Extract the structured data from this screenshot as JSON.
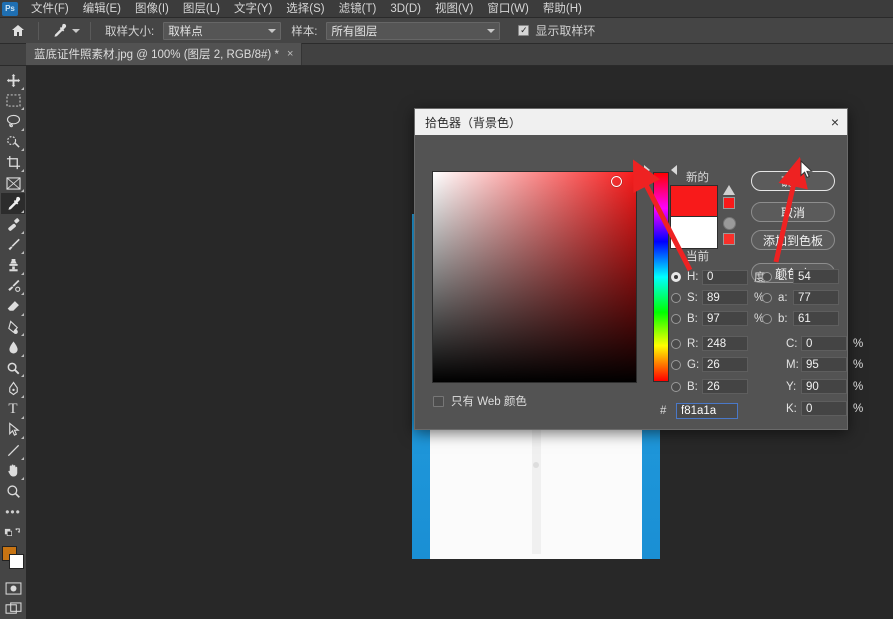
{
  "app": {
    "logo_text": "Ps"
  },
  "menubar": {
    "items": [
      {
        "label": "文件(F)",
        "name": "menu-file"
      },
      {
        "label": "编辑(E)",
        "name": "menu-edit"
      },
      {
        "label": "图像(I)",
        "name": "menu-image"
      },
      {
        "label": "图层(L)",
        "name": "menu-layer"
      },
      {
        "label": "文字(Y)",
        "name": "menu-type"
      },
      {
        "label": "选择(S)",
        "name": "menu-select"
      },
      {
        "label": "滤镜(T)",
        "name": "menu-filter"
      },
      {
        "label": "3D(D)",
        "name": "menu-3d"
      },
      {
        "label": "视图(V)",
        "name": "menu-view"
      },
      {
        "label": "窗口(W)",
        "name": "menu-window"
      },
      {
        "label": "帮助(H)",
        "name": "menu-help"
      }
    ]
  },
  "optionsbar": {
    "home_icon": "home-icon",
    "tool_icon": "eyedropper-icon",
    "sample_size_label": "取样大小:",
    "sample_size_value": "取样点",
    "sample_label": "样本:",
    "sample_value": "所有图层",
    "show_ring_label": "显示取样环",
    "show_ring_checked": true
  },
  "document_tab": {
    "title": "蓝底证件照素材.jpg @ 100% (图层 2, RGB/8#) *",
    "close_glyph": "×"
  },
  "toolbar": {
    "tools": [
      {
        "name": "move-tool",
        "glyph": "✥",
        "active": false
      },
      {
        "name": "marquee-tool",
        "glyph": "▭",
        "active": false
      },
      {
        "name": "lasso-tool",
        "glyph": "✂",
        "active": false
      },
      {
        "name": "quick-selection-tool",
        "glyph": "✐",
        "active": false
      },
      {
        "name": "crop-tool",
        "glyph": "⌗",
        "active": false
      },
      {
        "name": "frame-tool",
        "glyph": "⊠",
        "active": false
      },
      {
        "name": "eyedropper-tool",
        "glyph": "⚲",
        "active": true
      },
      {
        "name": "healing-brush-tool",
        "glyph": "✚",
        "active": false
      },
      {
        "name": "brush-tool",
        "glyph": "✎",
        "active": false
      },
      {
        "name": "clone-stamp-tool",
        "glyph": "♜",
        "active": false
      },
      {
        "name": "history-brush-tool",
        "glyph": "✾",
        "active": false
      },
      {
        "name": "eraser-tool",
        "glyph": "◣",
        "active": false
      },
      {
        "name": "gradient-tool",
        "glyph": "◨",
        "active": false
      },
      {
        "name": "blur-tool",
        "glyph": "◌",
        "active": false
      },
      {
        "name": "dodge-tool",
        "glyph": "●",
        "active": false
      },
      {
        "name": "pen-tool",
        "glyph": "✒",
        "active": false
      },
      {
        "name": "type-tool",
        "glyph": "T",
        "active": false
      },
      {
        "name": "path-selection-tool",
        "glyph": "➤",
        "active": false
      },
      {
        "name": "shape-tool",
        "glyph": "╱",
        "active": false
      },
      {
        "name": "hand-tool",
        "glyph": "✋",
        "active": false
      },
      {
        "name": "zoom-tool",
        "glyph": "🔍",
        "active": false
      }
    ],
    "more_tools_glyph": "•••",
    "foreground_color": "#c77413",
    "background_color": "#ffffff",
    "quickmask_icon": "quick-mask-icon",
    "screenmode_icon": "screen-mode-icon"
  },
  "dialog": {
    "title": "拾色器（背景色）",
    "close_glyph": "×",
    "new_label": "新的",
    "current_label": "当前",
    "new_color": "#f81a1a",
    "current_color": "#ffffff",
    "web_only_label": "只有 Web 颜色",
    "web_only_checked": false,
    "buttons": [
      {
        "name": "ok-button",
        "label": "确定",
        "id": "btn-ok",
        "primary": true
      },
      {
        "name": "cancel-button",
        "label": "取消",
        "id": "btn-cancel",
        "primary": false
      },
      {
        "name": "add-to-swatches-button",
        "label": "添加到色板",
        "id": "btn-addsw",
        "primary": false
      },
      {
        "name": "color-libraries-button",
        "label": "颜色库",
        "id": "btn-lib",
        "primary": false
      }
    ],
    "fields": {
      "H": {
        "label": "H:",
        "value": "0",
        "unit": "度",
        "selected": true
      },
      "S": {
        "label": "S:",
        "value": "89",
        "unit": "%",
        "selected": false
      },
      "B_hsb": {
        "label": "B:",
        "value": "97",
        "unit": "%",
        "selected": false
      },
      "L": {
        "label": "L:",
        "value": "54",
        "unit": "",
        "selected": false
      },
      "a": {
        "label": "a:",
        "value": "77",
        "unit": "",
        "selected": false
      },
      "b": {
        "label": "b:",
        "value": "61",
        "unit": "",
        "selected": false
      },
      "R": {
        "label": "R:",
        "value": "248",
        "unit": "",
        "selected": false
      },
      "G": {
        "label": "G:",
        "value": "26",
        "unit": "",
        "selected": false
      },
      "B_rgb": {
        "label": "B:",
        "value": "26",
        "unit": "",
        "selected": false
      },
      "C": {
        "label": "C:",
        "value": "0",
        "unit": "%",
        "selected": false
      },
      "M": {
        "label": "M:",
        "value": "95",
        "unit": "%",
        "selected": false
      },
      "Y": {
        "label": "Y:",
        "value": "90",
        "unit": "%",
        "selected": false
      },
      "K": {
        "label": "K:",
        "value": "0",
        "unit": "%",
        "selected": false
      }
    },
    "hex": {
      "prefix": "#",
      "value": "f81a1a"
    },
    "gamut_warning_icon": "out-of-gamut-warning-icon",
    "web_safe_icon": "web-safe-warning-icon"
  },
  "annotation": {
    "arrow_color": "#ee2222",
    "arrow_count": 2
  }
}
